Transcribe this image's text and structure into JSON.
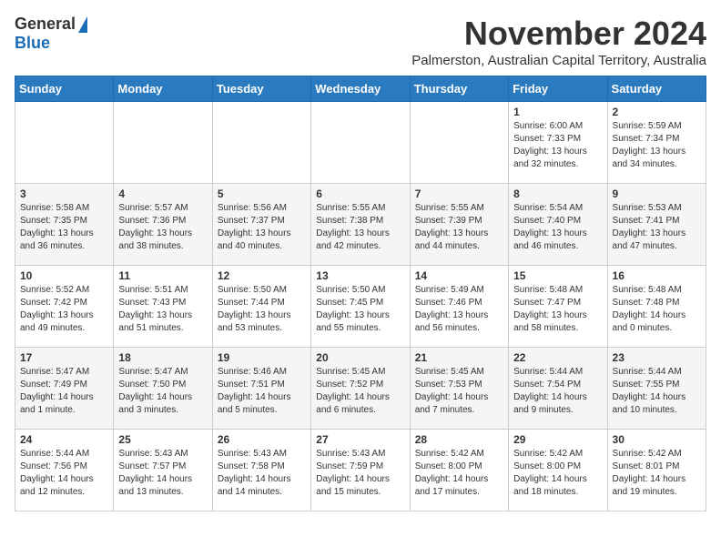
{
  "logo": {
    "general": "General",
    "blue": "Blue"
  },
  "header": {
    "month": "November 2024",
    "location": "Palmerston, Australian Capital Territory, Australia"
  },
  "weekdays": [
    "Sunday",
    "Monday",
    "Tuesday",
    "Wednesday",
    "Thursday",
    "Friday",
    "Saturday"
  ],
  "weeks": [
    [
      {
        "day": "",
        "info": ""
      },
      {
        "day": "",
        "info": ""
      },
      {
        "day": "",
        "info": ""
      },
      {
        "day": "",
        "info": ""
      },
      {
        "day": "",
        "info": ""
      },
      {
        "day": "1",
        "info": "Sunrise: 6:00 AM\nSunset: 7:33 PM\nDaylight: 13 hours\nand 32 minutes."
      },
      {
        "day": "2",
        "info": "Sunrise: 5:59 AM\nSunset: 7:34 PM\nDaylight: 13 hours\nand 34 minutes."
      }
    ],
    [
      {
        "day": "3",
        "info": "Sunrise: 5:58 AM\nSunset: 7:35 PM\nDaylight: 13 hours\nand 36 minutes."
      },
      {
        "day": "4",
        "info": "Sunrise: 5:57 AM\nSunset: 7:36 PM\nDaylight: 13 hours\nand 38 minutes."
      },
      {
        "day": "5",
        "info": "Sunrise: 5:56 AM\nSunset: 7:37 PM\nDaylight: 13 hours\nand 40 minutes."
      },
      {
        "day": "6",
        "info": "Sunrise: 5:55 AM\nSunset: 7:38 PM\nDaylight: 13 hours\nand 42 minutes."
      },
      {
        "day": "7",
        "info": "Sunrise: 5:55 AM\nSunset: 7:39 PM\nDaylight: 13 hours\nand 44 minutes."
      },
      {
        "day": "8",
        "info": "Sunrise: 5:54 AM\nSunset: 7:40 PM\nDaylight: 13 hours\nand 46 minutes."
      },
      {
        "day": "9",
        "info": "Sunrise: 5:53 AM\nSunset: 7:41 PM\nDaylight: 13 hours\nand 47 minutes."
      }
    ],
    [
      {
        "day": "10",
        "info": "Sunrise: 5:52 AM\nSunset: 7:42 PM\nDaylight: 13 hours\nand 49 minutes."
      },
      {
        "day": "11",
        "info": "Sunrise: 5:51 AM\nSunset: 7:43 PM\nDaylight: 13 hours\nand 51 minutes."
      },
      {
        "day": "12",
        "info": "Sunrise: 5:50 AM\nSunset: 7:44 PM\nDaylight: 13 hours\nand 53 minutes."
      },
      {
        "day": "13",
        "info": "Sunrise: 5:50 AM\nSunset: 7:45 PM\nDaylight: 13 hours\nand 55 minutes."
      },
      {
        "day": "14",
        "info": "Sunrise: 5:49 AM\nSunset: 7:46 PM\nDaylight: 13 hours\nand 56 minutes."
      },
      {
        "day": "15",
        "info": "Sunrise: 5:48 AM\nSunset: 7:47 PM\nDaylight: 13 hours\nand 58 minutes."
      },
      {
        "day": "16",
        "info": "Sunrise: 5:48 AM\nSunset: 7:48 PM\nDaylight: 14 hours\nand 0 minutes."
      }
    ],
    [
      {
        "day": "17",
        "info": "Sunrise: 5:47 AM\nSunset: 7:49 PM\nDaylight: 14 hours\nand 1 minute."
      },
      {
        "day": "18",
        "info": "Sunrise: 5:47 AM\nSunset: 7:50 PM\nDaylight: 14 hours\nand 3 minutes."
      },
      {
        "day": "19",
        "info": "Sunrise: 5:46 AM\nSunset: 7:51 PM\nDaylight: 14 hours\nand 5 minutes."
      },
      {
        "day": "20",
        "info": "Sunrise: 5:45 AM\nSunset: 7:52 PM\nDaylight: 14 hours\nand 6 minutes."
      },
      {
        "day": "21",
        "info": "Sunrise: 5:45 AM\nSunset: 7:53 PM\nDaylight: 14 hours\nand 7 minutes."
      },
      {
        "day": "22",
        "info": "Sunrise: 5:44 AM\nSunset: 7:54 PM\nDaylight: 14 hours\nand 9 minutes."
      },
      {
        "day": "23",
        "info": "Sunrise: 5:44 AM\nSunset: 7:55 PM\nDaylight: 14 hours\nand 10 minutes."
      }
    ],
    [
      {
        "day": "24",
        "info": "Sunrise: 5:44 AM\nSunset: 7:56 PM\nDaylight: 14 hours\nand 12 minutes."
      },
      {
        "day": "25",
        "info": "Sunrise: 5:43 AM\nSunset: 7:57 PM\nDaylight: 14 hours\nand 13 minutes."
      },
      {
        "day": "26",
        "info": "Sunrise: 5:43 AM\nSunset: 7:58 PM\nDaylight: 14 hours\nand 14 minutes."
      },
      {
        "day": "27",
        "info": "Sunrise: 5:43 AM\nSunset: 7:59 PM\nDaylight: 14 hours\nand 15 minutes."
      },
      {
        "day": "28",
        "info": "Sunrise: 5:42 AM\nSunset: 8:00 PM\nDaylight: 14 hours\nand 17 minutes."
      },
      {
        "day": "29",
        "info": "Sunrise: 5:42 AM\nSunset: 8:00 PM\nDaylight: 14 hours\nand 18 minutes."
      },
      {
        "day": "30",
        "info": "Sunrise: 5:42 AM\nSunset: 8:01 PM\nDaylight: 14 hours\nand 19 minutes."
      }
    ]
  ]
}
